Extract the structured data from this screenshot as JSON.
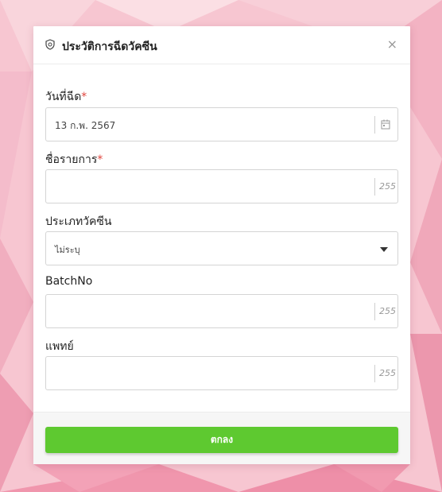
{
  "colors": {
    "accent": "#5ec930",
    "required": "#e0443c",
    "background": "#f6c3cf"
  },
  "dialog": {
    "title": "ประวัติการฉีดวัคซีน",
    "title_icon": "shield-icon",
    "close_label": "×"
  },
  "fields": {
    "injection_date": {
      "label": "วันที่ฉีด",
      "required_mark": "*",
      "value": "13 ก.พ. 2567",
      "icon": "calendar-icon"
    },
    "item_name": {
      "label": "ชื่อรายการ",
      "required_mark": "*",
      "value": "",
      "char_limit": "255"
    },
    "vaccine_type": {
      "label": "ประเภทวัคซีน",
      "selected": "ไม่ระบุ",
      "icon": "caret-down-icon"
    },
    "batch_no": {
      "label": "BatchNo",
      "value": "",
      "char_limit": "255"
    },
    "doctor": {
      "label": "แพทย์",
      "value": "",
      "char_limit": "255"
    }
  },
  "footer": {
    "ok_label": "ตกลง"
  }
}
